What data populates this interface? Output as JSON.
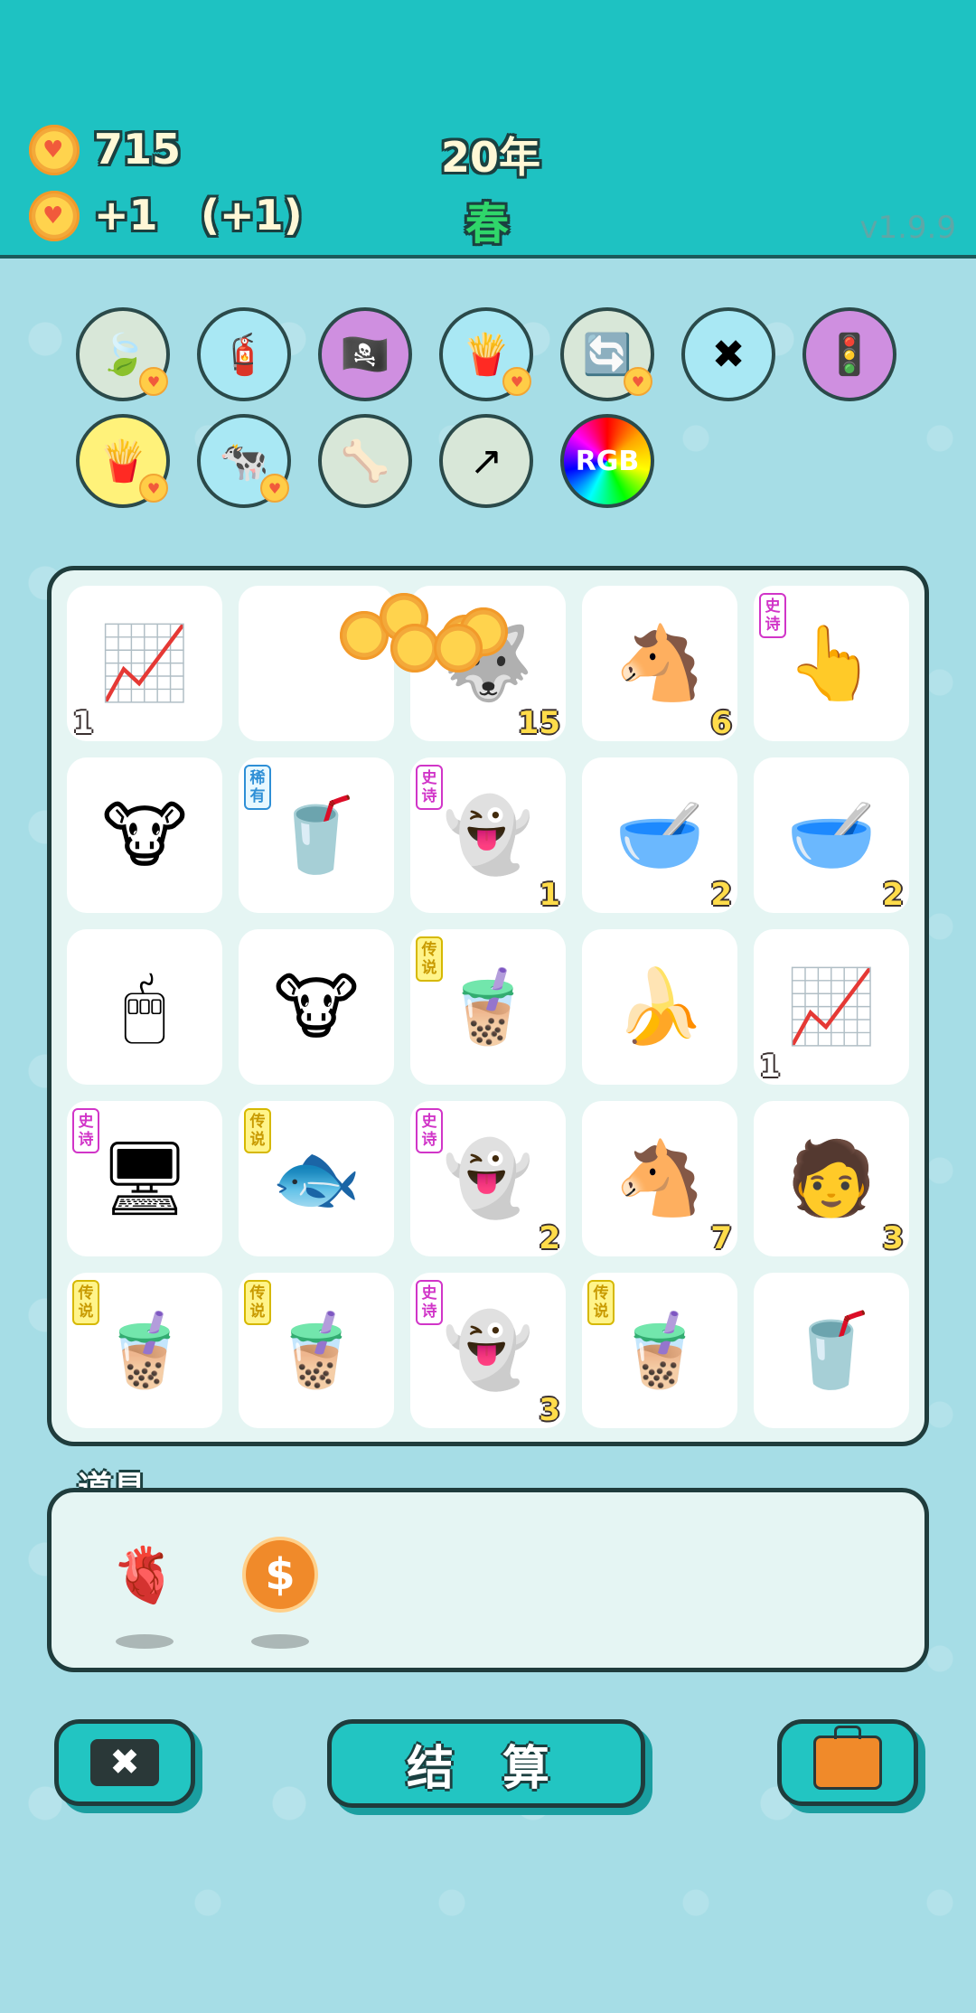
{
  "hud": {
    "coins": "715",
    "income": "+1",
    "bonus": "(+1)",
    "year": "20年",
    "season": "春",
    "version": "v1.9.9"
  },
  "skills_row1": [
    {
      "name": "leaf-icon",
      "glyph": "🍃",
      "bg": "#d8e7d8"
    },
    {
      "name": "pump-icon",
      "glyph": "🧯",
      "bg": "#a9e8f4"
    },
    {
      "name": "eyepatch-icon",
      "glyph": "🏴‍☠️",
      "bg": "#cf8fe0"
    },
    {
      "name": "fries-icon",
      "glyph": "🍟",
      "bg": "#a9e8f4"
    },
    {
      "name": "refresh-icon",
      "glyph": "🔄",
      "bg": "#d8e7d8"
    },
    {
      "name": "chopsticks-icon",
      "glyph": "✖",
      "bg": "#a9e8f4"
    },
    {
      "name": "ghost-traffic-icon",
      "glyph": "🚦",
      "bg": "#cf8fe0"
    }
  ],
  "skills_row2": [
    {
      "name": "fries-icon",
      "glyph": "🍟",
      "bg": "#fff27a"
    },
    {
      "name": "cows-icon",
      "glyph": "🐄",
      "bg": "#a9e8f4"
    },
    {
      "name": "pet-bowl-icon",
      "glyph": "🦴",
      "bg": "#d8e7d8"
    },
    {
      "name": "upgrade-arrow-icon",
      "glyph": "↗",
      "bg": "#d8e7d8"
    },
    {
      "name": "rgb-icon",
      "glyph": "RGB",
      "bg": "rainbow"
    }
  ],
  "grid": [
    {
      "item": "chart-card-icon",
      "glyph": "📈",
      "count": "1",
      "count_pos": "left"
    },
    {
      "item": "empty-cell",
      "glyph": "",
      "count": ""
    },
    {
      "item": "husky-icon",
      "glyph": "🐺",
      "count": "15"
    },
    {
      "item": "horse-icon",
      "glyph": "🐴",
      "count": "6"
    },
    {
      "item": "pointing-hand-icon",
      "glyph": "👆",
      "count": "",
      "tag": "史诗",
      "tag_type": "epic"
    },
    {
      "item": "cow-icon",
      "glyph": "🐮",
      "count": ""
    },
    {
      "item": "small-cup-icon",
      "glyph": "🥤",
      "count": "",
      "tag": "稀有",
      "tag_type": "rare"
    },
    {
      "item": "ghost-icon",
      "glyph": "👻",
      "count": "1",
      "tag": "史诗",
      "tag_type": "epic"
    },
    {
      "item": "glass-bowl-icon",
      "glyph": "🥣",
      "count": "2"
    },
    {
      "item": "glass-bowl-icon",
      "glyph": "🥣",
      "count": "2"
    },
    {
      "item": "mouse-icon",
      "glyph": "🖱",
      "count": ""
    },
    {
      "item": "cow-icon",
      "glyph": "🐮",
      "count": ""
    },
    {
      "item": "bubble-tea-icon",
      "glyph": "🧋",
      "count": "",
      "tag": "传说",
      "tag_type": "legend"
    },
    {
      "item": "banana-icon",
      "glyph": "🍌",
      "count": ""
    },
    {
      "item": "chart-card-icon",
      "glyph": "📈",
      "count": "1",
      "count_pos": "left"
    },
    {
      "item": "graphics-card-icon",
      "glyph": "🖥",
      "count": "",
      "tag": "史诗",
      "tag_type": "epic"
    },
    {
      "item": "koi-fish-icon",
      "glyph": "🐟",
      "count": "",
      "tag": "传说",
      "tag_type": "legend"
    },
    {
      "item": "ghost-icon",
      "glyph": "👻",
      "count": "2",
      "tag": "史诗",
      "tag_type": "epic"
    },
    {
      "item": "horse-icon",
      "glyph": "🐴",
      "count": "7"
    },
    {
      "item": "masked-man-icon",
      "glyph": "🧑",
      "count": "3"
    },
    {
      "item": "bubble-tea-icon",
      "glyph": "🧋",
      "count": "",
      "tag": "传说",
      "tag_type": "legend"
    },
    {
      "item": "bubble-tea-icon",
      "glyph": "🧋",
      "count": "",
      "tag": "传说",
      "tag_type": "legend"
    },
    {
      "item": "ghost-icon",
      "glyph": "👻",
      "count": "3",
      "tag": "史诗",
      "tag_type": "epic"
    },
    {
      "item": "bubble-tea-icon",
      "glyph": "🧋",
      "count": "",
      "tag": "传说",
      "tag_type": "legend"
    },
    {
      "item": "small-cup-icon",
      "glyph": "🥤",
      "count": ""
    }
  ],
  "tools": {
    "title": "道具",
    "items": [
      {
        "name": "liver-icon",
        "glyph": "🫀"
      },
      {
        "name": "dollar-coin-icon",
        "glyph": "$"
      }
    ]
  },
  "buttons": {
    "settle": "结 算"
  }
}
